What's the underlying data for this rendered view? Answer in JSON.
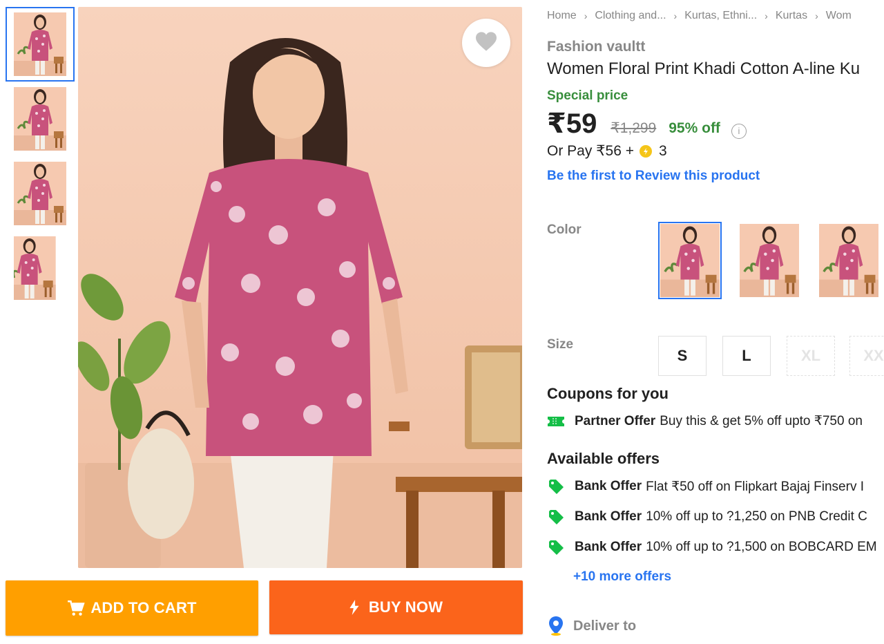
{
  "thumbnails": [
    {
      "label": "thumbnail-1",
      "active": true
    },
    {
      "label": "thumbnail-2",
      "active": false
    },
    {
      "label": "thumbnail-3",
      "active": false
    },
    {
      "label": "thumbnail-4",
      "active": false
    }
  ],
  "breadcrumbs": [
    "Home",
    "Clothing and...",
    "Kurtas, Ethni...",
    "Kurtas",
    "Wom"
  ],
  "product": {
    "brand": "Fashion vaultt",
    "title": "Women Floral Print Khadi Cotton A-line Ku",
    "special_label": "Special price",
    "price": "₹59",
    "mrp": "₹1,299",
    "discount": "95% off",
    "info_icon": "i",
    "or_pay_prefix": "Or Pay ₹56 +",
    "or_pay_coins": "3",
    "review_link": "Be the first to Review this product"
  },
  "color": {
    "label": "Color",
    "selected_index": 0
  },
  "size": {
    "label": "Size",
    "options": [
      {
        "value": "S",
        "available": true
      },
      {
        "value": "L",
        "available": true
      },
      {
        "value": "XL",
        "available": false
      },
      {
        "value": "XX",
        "available": false
      }
    ]
  },
  "coupons": {
    "title": "Coupons for you",
    "items": [
      {
        "type": "Partner Offer",
        "text": "Buy this & get 5% off upto ₹750 on"
      }
    ]
  },
  "offers": {
    "title": "Available offers",
    "items": [
      {
        "type": "Bank Offer",
        "text": "Flat ₹50 off on Flipkart Bajaj Finserv I"
      },
      {
        "type": "Bank Offer",
        "text": "10% off up to ?1,250 on PNB Credit C"
      },
      {
        "type": "Bank Offer",
        "text": "10% off up to ?1,500 on BOBCARD EM"
      }
    ],
    "more_link": "+10 more offers"
  },
  "deliver_label": "Deliver to",
  "actions": {
    "add_to_cart": "ADD TO CART",
    "buy_now": "BUY NOW"
  },
  "colors": {
    "flipkart_blue": "#2874f0",
    "cart_yellow": "#ff9f00",
    "buy_orange": "#fb641b",
    "offer_green": "#388e3c",
    "kurta_pink": "#c8527c"
  },
  "icons": [
    "heart-icon",
    "cart-icon",
    "lightning-icon",
    "info-icon",
    "coin-icon",
    "coupon-icon",
    "offer-tag-icon",
    "location-pin-icon"
  ]
}
